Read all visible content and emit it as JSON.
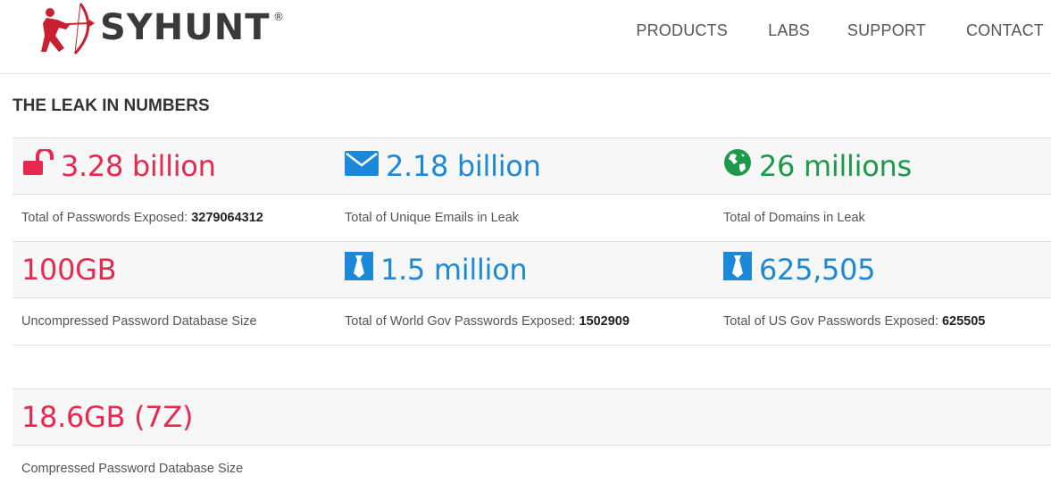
{
  "header": {
    "logo_text": "SYHUNT",
    "nav": [
      {
        "label": "PRODUCTS"
      },
      {
        "label": "LABS"
      },
      {
        "label": "SUPPORT"
      },
      {
        "label": "CONTACT"
      }
    ]
  },
  "section": {
    "title": "THE LEAK IN NUMBERS"
  },
  "stats": {
    "row1": {
      "passwords": {
        "value": "3.28 billion",
        "label": "Total of Passwords Exposed:",
        "detail": "3279064312",
        "icon": "unlock-icon",
        "color": "#e8294f"
      },
      "emails": {
        "value": "2.18 billion",
        "label": "Total of Unique Emails in Leak",
        "icon": "envelope-icon",
        "color": "#1b88d9"
      },
      "domains": {
        "value": "26 millions",
        "label": "Total of Domains in Leak",
        "icon": "globe-icon",
        "color": "#1c9a4a"
      }
    },
    "row2": {
      "db_size": {
        "value": "100GB",
        "label": "Uncompressed Password Database Size",
        "color": "#e8294f"
      },
      "world_gov": {
        "value": "1.5 million",
        "label": "Total of World Gov Passwords Exposed:",
        "detail": "1502909",
        "icon": "tie-icon",
        "color": "#1b88d9"
      },
      "us_gov": {
        "value": "625,505",
        "label": "Total of US Gov Passwords Exposed:",
        "detail": "625505",
        "icon": "tie-icon",
        "color": "#1b88d9"
      }
    },
    "row3": {
      "compressed": {
        "value": "18.6GB (7Z)",
        "label": "Compressed Password Database Size",
        "color": "#e8294f"
      }
    }
  }
}
